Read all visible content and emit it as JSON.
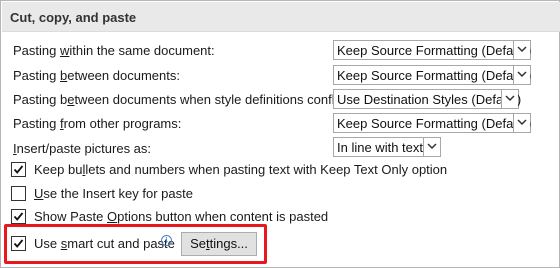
{
  "section": {
    "title": "Cut, copy, and paste"
  },
  "rows": [
    {
      "label_pre": "Pasting ",
      "label_key": "w",
      "label_post": "ithin the same document:",
      "value": "Keep Source Formatting (Default)"
    },
    {
      "label_pre": "Pasting ",
      "label_key": "b",
      "label_post": "etween documents:",
      "value": "Keep Source Formatting (Default)"
    },
    {
      "label_pre": "Pasting b",
      "label_key": "e",
      "label_post": "tween documents when style definitions conflict:",
      "value": "Use Destination Styles (Default)"
    },
    {
      "label_pre": "Pasting ",
      "label_key": "f",
      "label_post": "rom other programs:",
      "value": "Keep Source Formatting (Default)"
    },
    {
      "label_pre": "",
      "label_key": "I",
      "label_post": "nsert/paste pictures as:",
      "value": "In line with text"
    }
  ],
  "options": [
    {
      "label_pre": "Keep bu",
      "label_key": "l",
      "label_post": "lets and numbers when pasting text with Keep Text Only option",
      "checked": true
    },
    {
      "label_pre": "",
      "label_key": "U",
      "label_post": "se the Insert key for paste",
      "checked": false
    },
    {
      "label_pre": "Show Paste ",
      "label_key": "O",
      "label_post": "ptions button when content is pasted",
      "checked": true
    },
    {
      "label_pre": "Use ",
      "label_key": "s",
      "label_post": "mart cut and paste",
      "checked": true
    }
  ],
  "smart_cut": {
    "info_glyph": "i",
    "settings_label_key": "t",
    "settings_label_pre": "Se",
    "settings_label_post": "tings..."
  },
  "colors": {
    "highlight": "#e8181e",
    "header_bg": "#e9e9e9"
  }
}
